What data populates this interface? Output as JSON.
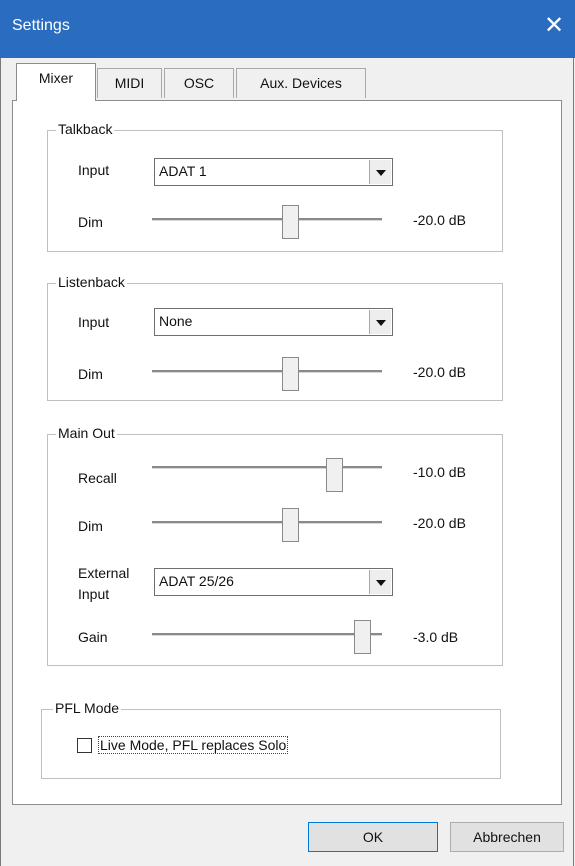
{
  "window": {
    "title": "Settings",
    "close_glyph": "✕"
  },
  "tabs": [
    {
      "label": "Mixer",
      "active": true
    },
    {
      "label": "MIDI",
      "active": false
    },
    {
      "label": "OSC",
      "active": false
    },
    {
      "label": "Aux. Devices",
      "active": false
    }
  ],
  "talkback": {
    "title": "Talkback",
    "input_label": "Input",
    "input_value": "ADAT 1",
    "dim_label": "Dim",
    "dim_value": "-20.0 dB",
    "dim_level": 0.6
  },
  "listenback": {
    "title": "Listenback",
    "input_label": "Input",
    "input_value": "None",
    "dim_label": "Dim",
    "dim_value": "-20.0 dB",
    "dim_level": 0.6
  },
  "main_out": {
    "title": "Main Out",
    "recall_label": "Recall",
    "recall_value": "-10.0 dB",
    "recall_level": 0.8,
    "dim_label": "Dim",
    "dim_value": "-20.0 dB",
    "dim_level": 0.6,
    "external_input_label_1": "External",
    "external_input_label_2": "Input",
    "external_input_value": "ADAT 25/26",
    "gain_label": "Gain",
    "gain_value": "-3.0 dB",
    "gain_level": 0.94
  },
  "pfl": {
    "title": "PFL Mode",
    "checkbox_label": "Live Mode,  PFL replaces Solo",
    "checked": false
  },
  "buttons": {
    "ok": "OK",
    "cancel": "Abbrechen"
  }
}
